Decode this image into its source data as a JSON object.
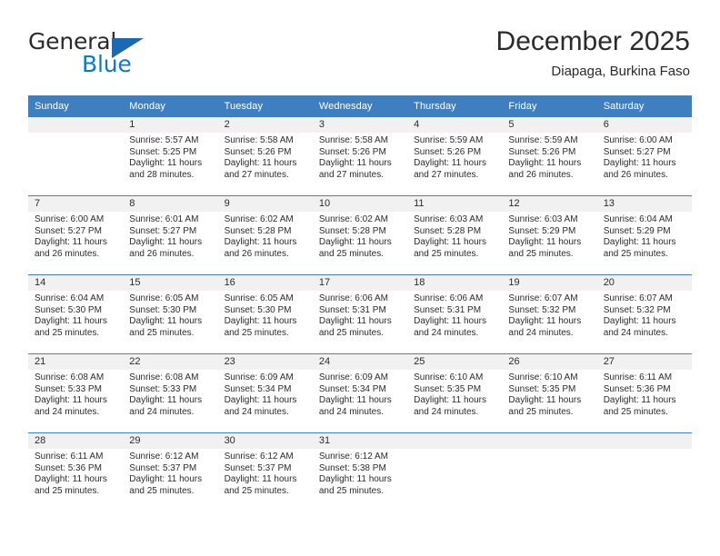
{
  "logo": {
    "word1": "General",
    "word2": "Blue",
    "triangle_color": "#1b69b3",
    "blue_color": "#1178c4"
  },
  "header": {
    "title": "December 2025",
    "subtitle": "Diapaga, Burkina Faso",
    "accent_color": "#3f7fbf"
  },
  "calendar": {
    "weekday_headers": [
      "Sunday",
      "Monday",
      "Tuesday",
      "Wednesday",
      "Thursday",
      "Friday",
      "Saturday"
    ],
    "labels": {
      "sunrise": "Sunrise:",
      "sunset": "Sunset:",
      "daylight": "Daylight:"
    },
    "weeks": [
      [
        {
          "day": "",
          "sunrise": "",
          "sunset": "",
          "daylight": "",
          "empty": true
        },
        {
          "day": "1",
          "sunrise": "Sunrise: 5:57 AM",
          "sunset": "Sunset: 5:25 PM",
          "daylight": "Daylight: 11 hours and 28 minutes."
        },
        {
          "day": "2",
          "sunrise": "Sunrise: 5:58 AM",
          "sunset": "Sunset: 5:26 PM",
          "daylight": "Daylight: 11 hours and 27 minutes."
        },
        {
          "day": "3",
          "sunrise": "Sunrise: 5:58 AM",
          "sunset": "Sunset: 5:26 PM",
          "daylight": "Daylight: 11 hours and 27 minutes."
        },
        {
          "day": "4",
          "sunrise": "Sunrise: 5:59 AM",
          "sunset": "Sunset: 5:26 PM",
          "daylight": "Daylight: 11 hours and 27 minutes."
        },
        {
          "day": "5",
          "sunrise": "Sunrise: 5:59 AM",
          "sunset": "Sunset: 5:26 PM",
          "daylight": "Daylight: 11 hours and 26 minutes."
        },
        {
          "day": "6",
          "sunrise": "Sunrise: 6:00 AM",
          "sunset": "Sunset: 5:27 PM",
          "daylight": "Daylight: 11 hours and 26 minutes."
        }
      ],
      [
        {
          "day": "7",
          "sunrise": "Sunrise: 6:00 AM",
          "sunset": "Sunset: 5:27 PM",
          "daylight": "Daylight: 11 hours and 26 minutes."
        },
        {
          "day": "8",
          "sunrise": "Sunrise: 6:01 AM",
          "sunset": "Sunset: 5:27 PM",
          "daylight": "Daylight: 11 hours and 26 minutes."
        },
        {
          "day": "9",
          "sunrise": "Sunrise: 6:02 AM",
          "sunset": "Sunset: 5:28 PM",
          "daylight": "Daylight: 11 hours and 26 minutes."
        },
        {
          "day": "10",
          "sunrise": "Sunrise: 6:02 AM",
          "sunset": "Sunset: 5:28 PM",
          "daylight": "Daylight: 11 hours and 25 minutes."
        },
        {
          "day": "11",
          "sunrise": "Sunrise: 6:03 AM",
          "sunset": "Sunset: 5:28 PM",
          "daylight": "Daylight: 11 hours and 25 minutes."
        },
        {
          "day": "12",
          "sunrise": "Sunrise: 6:03 AM",
          "sunset": "Sunset: 5:29 PM",
          "daylight": "Daylight: 11 hours and 25 minutes."
        },
        {
          "day": "13",
          "sunrise": "Sunrise: 6:04 AM",
          "sunset": "Sunset: 5:29 PM",
          "daylight": "Daylight: 11 hours and 25 minutes."
        }
      ],
      [
        {
          "day": "14",
          "sunrise": "Sunrise: 6:04 AM",
          "sunset": "Sunset: 5:30 PM",
          "daylight": "Daylight: 11 hours and 25 minutes."
        },
        {
          "day": "15",
          "sunrise": "Sunrise: 6:05 AM",
          "sunset": "Sunset: 5:30 PM",
          "daylight": "Daylight: 11 hours and 25 minutes."
        },
        {
          "day": "16",
          "sunrise": "Sunrise: 6:05 AM",
          "sunset": "Sunset: 5:30 PM",
          "daylight": "Daylight: 11 hours and 25 minutes."
        },
        {
          "day": "17",
          "sunrise": "Sunrise: 6:06 AM",
          "sunset": "Sunset: 5:31 PM",
          "daylight": "Daylight: 11 hours and 25 minutes."
        },
        {
          "day": "18",
          "sunrise": "Sunrise: 6:06 AM",
          "sunset": "Sunset: 5:31 PM",
          "daylight": "Daylight: 11 hours and 24 minutes."
        },
        {
          "day": "19",
          "sunrise": "Sunrise: 6:07 AM",
          "sunset": "Sunset: 5:32 PM",
          "daylight": "Daylight: 11 hours and 24 minutes."
        },
        {
          "day": "20",
          "sunrise": "Sunrise: 6:07 AM",
          "sunset": "Sunset: 5:32 PM",
          "daylight": "Daylight: 11 hours and 24 minutes."
        }
      ],
      [
        {
          "day": "21",
          "sunrise": "Sunrise: 6:08 AM",
          "sunset": "Sunset: 5:33 PM",
          "daylight": "Daylight: 11 hours and 24 minutes."
        },
        {
          "day": "22",
          "sunrise": "Sunrise: 6:08 AM",
          "sunset": "Sunset: 5:33 PM",
          "daylight": "Daylight: 11 hours and 24 minutes."
        },
        {
          "day": "23",
          "sunrise": "Sunrise: 6:09 AM",
          "sunset": "Sunset: 5:34 PM",
          "daylight": "Daylight: 11 hours and 24 minutes."
        },
        {
          "day": "24",
          "sunrise": "Sunrise: 6:09 AM",
          "sunset": "Sunset: 5:34 PM",
          "daylight": "Daylight: 11 hours and 24 minutes."
        },
        {
          "day": "25",
          "sunrise": "Sunrise: 6:10 AM",
          "sunset": "Sunset: 5:35 PM",
          "daylight": "Daylight: 11 hours and 24 minutes."
        },
        {
          "day": "26",
          "sunrise": "Sunrise: 6:10 AM",
          "sunset": "Sunset: 5:35 PM",
          "daylight": "Daylight: 11 hours and 25 minutes."
        },
        {
          "day": "27",
          "sunrise": "Sunrise: 6:11 AM",
          "sunset": "Sunset: 5:36 PM",
          "daylight": "Daylight: 11 hours and 25 minutes."
        }
      ],
      [
        {
          "day": "28",
          "sunrise": "Sunrise: 6:11 AM",
          "sunset": "Sunset: 5:36 PM",
          "daylight": "Daylight: 11 hours and 25 minutes."
        },
        {
          "day": "29",
          "sunrise": "Sunrise: 6:12 AM",
          "sunset": "Sunset: 5:37 PM",
          "daylight": "Daylight: 11 hours and 25 minutes."
        },
        {
          "day": "30",
          "sunrise": "Sunrise: 6:12 AM",
          "sunset": "Sunset: 5:37 PM",
          "daylight": "Daylight: 11 hours and 25 minutes."
        },
        {
          "day": "31",
          "sunrise": "Sunrise: 6:12 AM",
          "sunset": "Sunset: 5:38 PM",
          "daylight": "Daylight: 11 hours and 25 minutes."
        },
        {
          "day": "",
          "sunrise": "",
          "sunset": "",
          "daylight": "",
          "empty": true
        },
        {
          "day": "",
          "sunrise": "",
          "sunset": "",
          "daylight": "",
          "empty": true
        },
        {
          "day": "",
          "sunrise": "",
          "sunset": "",
          "daylight": "",
          "empty": true
        }
      ]
    ]
  }
}
